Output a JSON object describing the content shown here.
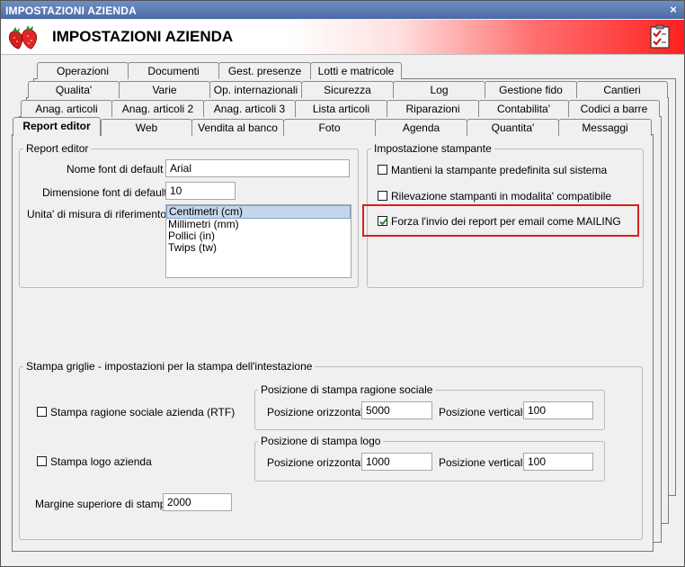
{
  "window": {
    "title": "IMPOSTAZIONI AZIENDA",
    "close_glyph": "×",
    "header_title": "IMPOSTAZIONI AZIENDA",
    "logo_icon": "strawberry-icon",
    "header_icon": "checklist-icon"
  },
  "tabs": {
    "row1": [
      "Operazioni",
      "Documenti",
      "Gest. presenze",
      "Lotti e matricole"
    ],
    "row2": [
      "Qualita'",
      "Varie",
      "Op. internazionali",
      "Sicurezza",
      "Log",
      "Gestione fido",
      "Cantieri"
    ],
    "row3": [
      "Anag. articoli",
      "Anag. articoli 2",
      "Anag. articoli 3",
      "Lista articoli",
      "Riparazioni",
      "Contabilita'",
      "Codici a barre"
    ],
    "row4": [
      "Report editor",
      "Web",
      "Vendita al banco",
      "Foto",
      "Agenda",
      "Quantita'",
      "Messaggi"
    ],
    "active": "Report editor"
  },
  "report_editor": {
    "legend": "Report editor",
    "font_label": "Nome font di default :",
    "font_value": "Arial",
    "size_label": "Dimensione font di default :",
    "size_value": "10",
    "unit_label": "Unita' di misura di riferimento :",
    "units": [
      "Centimetri (cm)",
      "Millimetri (mm)",
      "Pollici (in)",
      "Twips (tw)"
    ],
    "selected_unit": "Centimetri (cm)"
  },
  "printer": {
    "legend": "Impostazione stampante",
    "opt1": "Mantieni la stampante predefinita sul sistema",
    "opt1_checked": false,
    "opt2": "Rilevazione stampanti in modalita' compatibile",
    "opt2_checked": false,
    "opt3": "Forza l'invio dei report per email come MAILING",
    "opt3_checked": true,
    "highlight_color": "#d42020"
  },
  "grid": {
    "legend": "Stampa griglie - impostazioni per la stampa dell'intestazione",
    "ragione_label": "Stampa ragione sociale azienda (RTF)",
    "ragione_checked": false,
    "logo_label": "Stampa logo azienda",
    "logo_checked": false,
    "margin_label": "Margine superiore di stampa",
    "margin_value": "2000",
    "pos_ragione": {
      "legend": "Posizione di stampa ragione sociale",
      "h_label": "Posizione orizzontale",
      "h_value": "5000",
      "v_label": "Posizione verticale",
      "v_value": "100"
    },
    "pos_logo": {
      "legend": "Posizione di stampa logo",
      "h_label": "Posizione orizzontale",
      "h_value": "1000",
      "v_label": "Posizione verticale",
      "v_value": "100"
    }
  }
}
